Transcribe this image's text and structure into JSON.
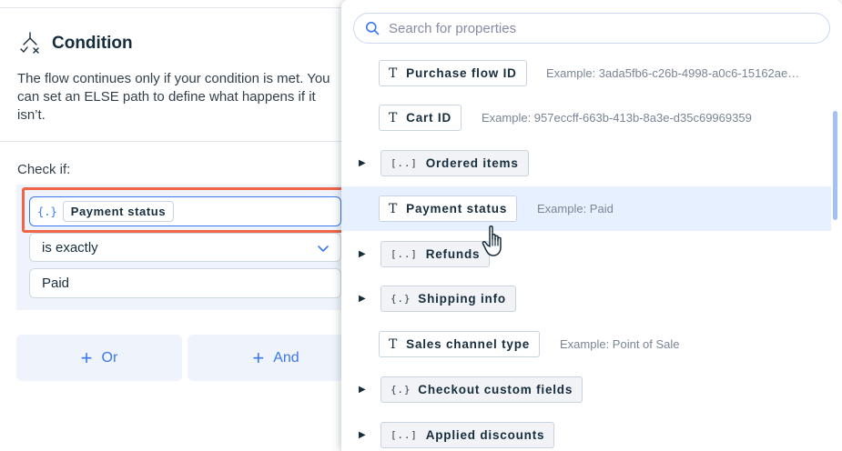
{
  "condition": {
    "title": "Condition",
    "description": "The flow continues only if your condition is met. You can set an ELSE path to define what happens if it isn’t.",
    "check_if_label": "Check if:",
    "variable_chip": "Payment status",
    "variable_brace": "{.}",
    "operator": "is exactly",
    "value": "Paid",
    "or_label": "Or",
    "and_label": "And"
  },
  "dropdown": {
    "search_placeholder": "Search for properties",
    "items": [
      {
        "label": "Purchase flow ID",
        "icon": "text-icon",
        "icon_glyph": "T",
        "example": "Example: 3ada5fb6-c26b-4998-a0c6-15162ae…",
        "expandable": false
      },
      {
        "label": "Cart ID",
        "icon": "text-icon",
        "icon_glyph": "T",
        "example": "Example: 957eccff-663b-413b-8a3e-d35c69969359",
        "expandable": false
      },
      {
        "label": "Ordered items",
        "icon": "array-icon",
        "icon_glyph": "[..]",
        "example": "",
        "expandable": true
      },
      {
        "label": "Payment status",
        "icon": "text-icon",
        "icon_glyph": "T",
        "example": "Example: Paid",
        "expandable": false,
        "selected": true
      },
      {
        "label": "Refunds",
        "icon": "array-icon",
        "icon_glyph": "[..]",
        "example": "",
        "expandable": true
      },
      {
        "label": "Shipping info",
        "icon": "object-icon",
        "icon_glyph": "{.}",
        "example": "",
        "expandable": true
      },
      {
        "label": "Sales channel type",
        "icon": "text-icon",
        "icon_glyph": "T",
        "example": "Example: Point of Sale",
        "expandable": false
      },
      {
        "label": "Checkout custom fields",
        "icon": "object-icon",
        "icon_glyph": "{.}",
        "example": "",
        "expandable": true
      },
      {
        "label": "Applied discounts",
        "icon": "array-icon",
        "icon_glyph": "[..]",
        "example": "",
        "expandable": true
      }
    ]
  },
  "colors": {
    "accent": "#3b77f0",
    "highlight_border": "#f06448",
    "selected_row": "#e7f0ff",
    "panel_bg": "#eff4fc"
  }
}
